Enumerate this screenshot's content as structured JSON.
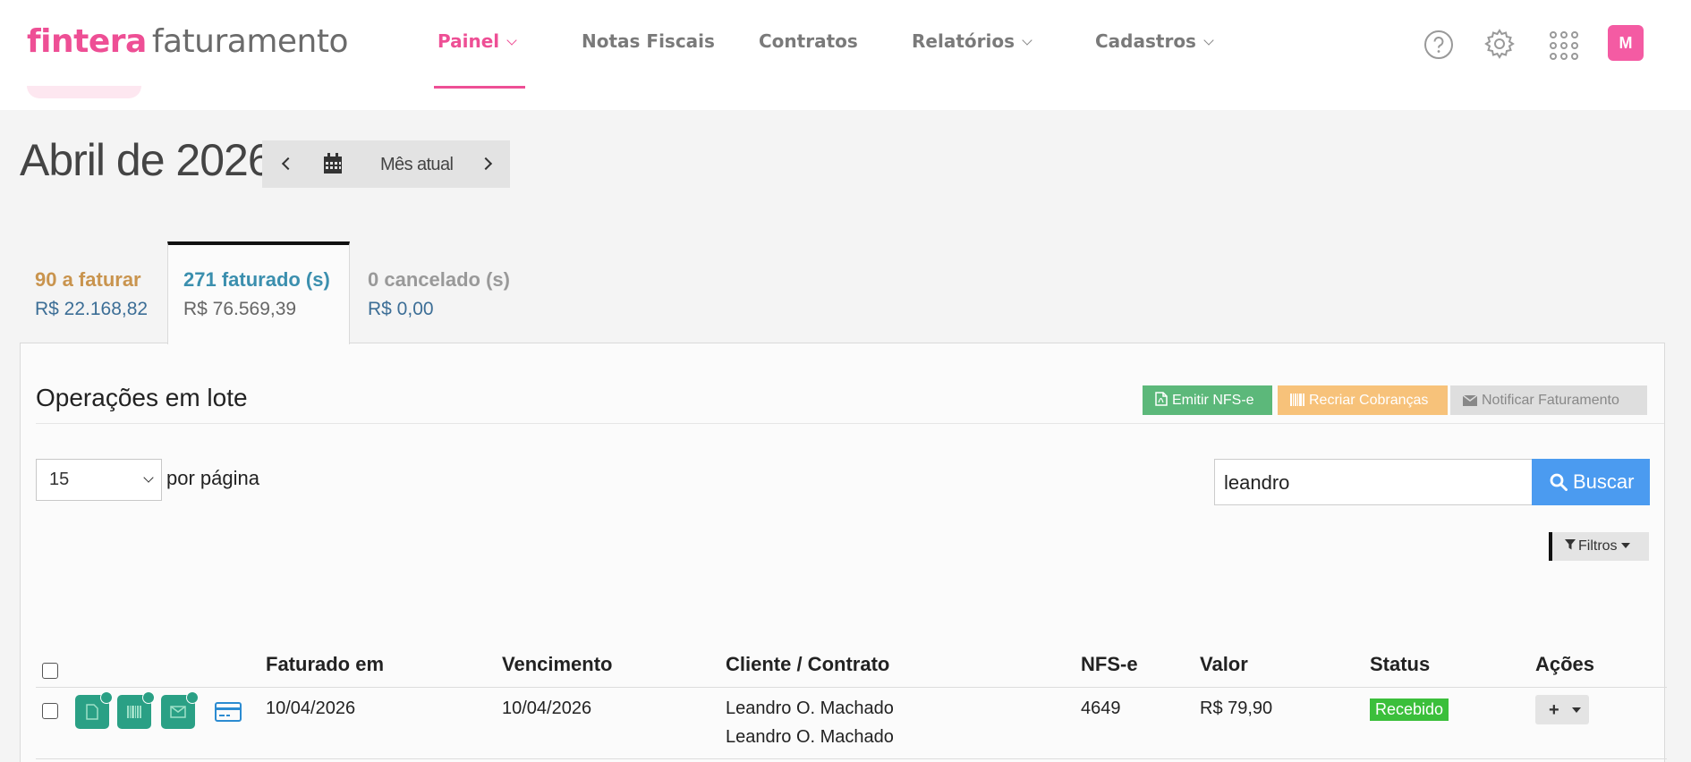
{
  "header": {
    "brand_primary": "fintera",
    "brand_secondary": "faturamento",
    "nav": [
      {
        "label": "Painel",
        "active": true,
        "has_dropdown": true
      },
      {
        "label": "Notas Fiscais",
        "active": false,
        "has_dropdown": false
      },
      {
        "label": "Contratos",
        "active": false,
        "has_dropdown": false
      },
      {
        "label": "Relatórios",
        "active": false,
        "has_dropdown": true
      },
      {
        "label": "Cadastros",
        "active": false,
        "has_dropdown": true
      }
    ],
    "icons": [
      "help-icon",
      "gear-icon",
      "apps-grid-icon"
    ],
    "avatar_initial": "M",
    "accent_color": "#ee4f95"
  },
  "month": {
    "title": "Abril de 2026",
    "current_label": "Mês atual"
  },
  "tabs": [
    {
      "title": "90 a faturar",
      "amount": "R$ 22.168,82",
      "active": false
    },
    {
      "title": "271 faturado (s)",
      "amount": "R$ 76.569,39",
      "active": true
    },
    {
      "title": "0 cancelado (s)",
      "amount": "R$ 0,00",
      "active": false
    }
  ],
  "panel": {
    "title": "Operações em lote",
    "batch_buttons": {
      "emit": "Emitir NFS-e",
      "recreate": "Recriar Cobranças",
      "notify": "Notificar Faturamento"
    },
    "per_page_value": "15",
    "per_page_label": "por página",
    "search_value": "leandro",
    "search_button": "Buscar",
    "filters_button": "Filtros"
  },
  "table": {
    "headers": {
      "billed_at": "Faturado em",
      "due": "Vencimento",
      "client": "Cliente / Contrato",
      "nfse": "NFS-e",
      "value": "Valor",
      "status": "Status",
      "actions": "Ações"
    },
    "rows": [
      {
        "billed_at": "10/04/2026",
        "due": "10/04/2026",
        "client": "Leandro O. Machado",
        "contract": "Leandro O. Machado",
        "nfse": "4649",
        "value": "R$ 79,90",
        "status": "Recebido",
        "status_color": "#3bbf3b"
      }
    ]
  }
}
